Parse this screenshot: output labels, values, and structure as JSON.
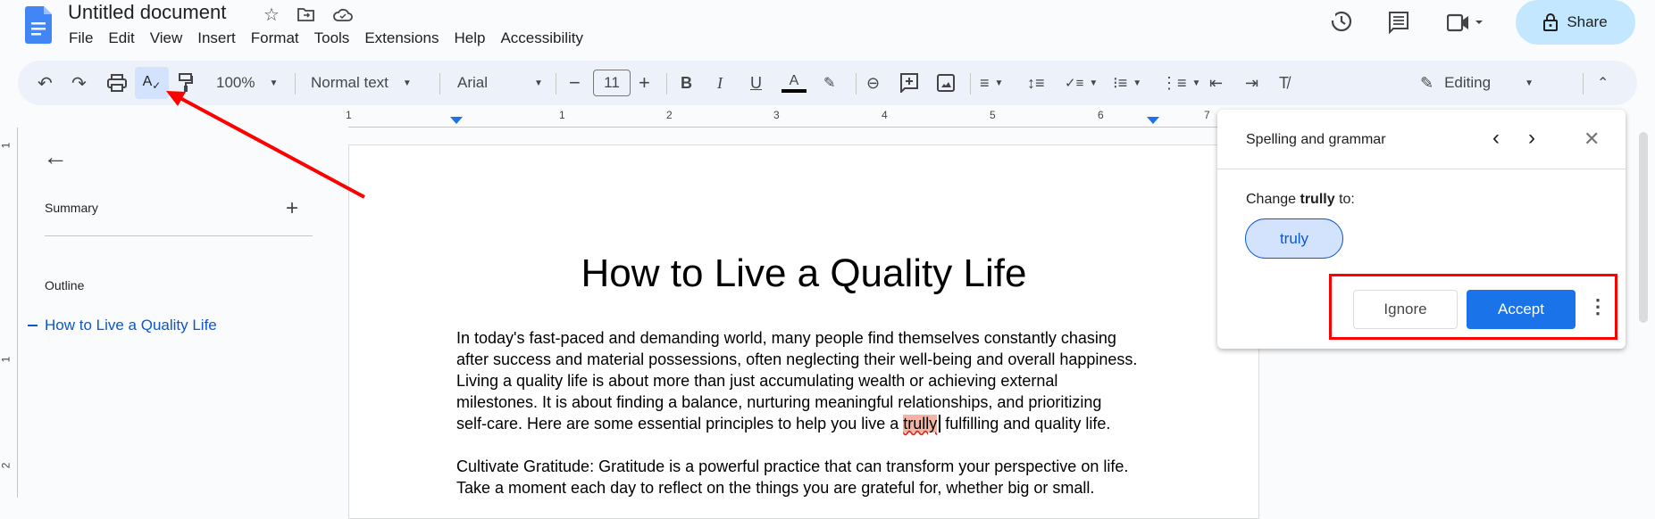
{
  "app": {
    "title": "Untitled document",
    "menu": [
      "File",
      "Edit",
      "View",
      "Insert",
      "Format",
      "Tools",
      "Extensions",
      "Help",
      "Accessibility"
    ],
    "share_label": "Share",
    "colors": {
      "accent": "#1a73e8",
      "share_bg": "#c2e7ff",
      "toolbar_bg": "#edf2fa",
      "highlight": "#f4b4a3",
      "annotation": "#ff0000"
    }
  },
  "toolbar": {
    "zoom": "100%",
    "style": "Normal text",
    "font": "Arial",
    "font_size": "11",
    "mode": "Editing"
  },
  "ruler": {
    "numbers": [
      "1",
      "1",
      "2",
      "3",
      "4",
      "5",
      "6",
      "7"
    ],
    "vertical": [
      "1",
      "1",
      "2"
    ]
  },
  "sidebar": {
    "summary": "Summary",
    "outline": "Outline",
    "outline_items": [
      "How to Live a Quality Life"
    ]
  },
  "document": {
    "title": "How to Live a Quality Life",
    "para1": [
      "In today's fast-paced and demanding world, many people find themselves constantly chasing",
      "after success and material possessions, often neglecting their well-being and overall happiness.",
      "Living a quality life is about more than just accumulating wealth or achieving external",
      "milestones. It is about finding a balance, nurturing meaningful relationships, and prioritizing"
    ],
    "para1_last_before": "self-care. Here are some essential principles to help you live a ",
    "misspelled": "trully",
    "para1_last_after": " fulfilling and quality life.",
    "para2": [
      "Cultivate Gratitude: Gratitude is a powerful practice that can transform your perspective on life.",
      "Take a moment each day to reflect on the things you are grateful for, whether big or small."
    ]
  },
  "spell_panel": {
    "title": "Spelling and grammar",
    "change_prefix": "Change ",
    "word": "trully",
    "change_suffix": " to:",
    "suggestion": "truly",
    "ignore": "Ignore",
    "accept": "Accept"
  }
}
